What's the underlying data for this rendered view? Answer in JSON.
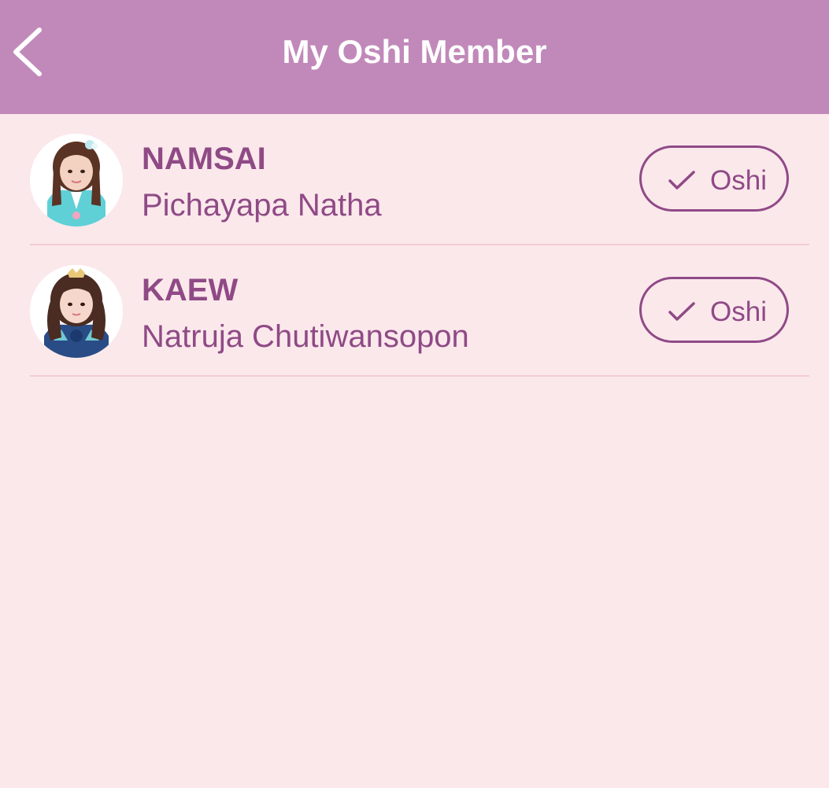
{
  "header": {
    "title": "My Oshi Member",
    "back_icon": "chevron-left-icon",
    "background_color": "#c189ba"
  },
  "members": [
    {
      "nickname": "NAMSAI",
      "full_name": "Pichayapa Natha",
      "button_label": "Oshi",
      "button_icon": "check-icon"
    },
    {
      "nickname": "KAEW",
      "full_name": "Natruja Chutiwansopon",
      "button_label": "Oshi",
      "button_icon": "check-icon"
    }
  ],
  "colors": {
    "page_background": "#fbe8eb",
    "accent": "#8f4a86",
    "divider": "#f2cdd3"
  }
}
